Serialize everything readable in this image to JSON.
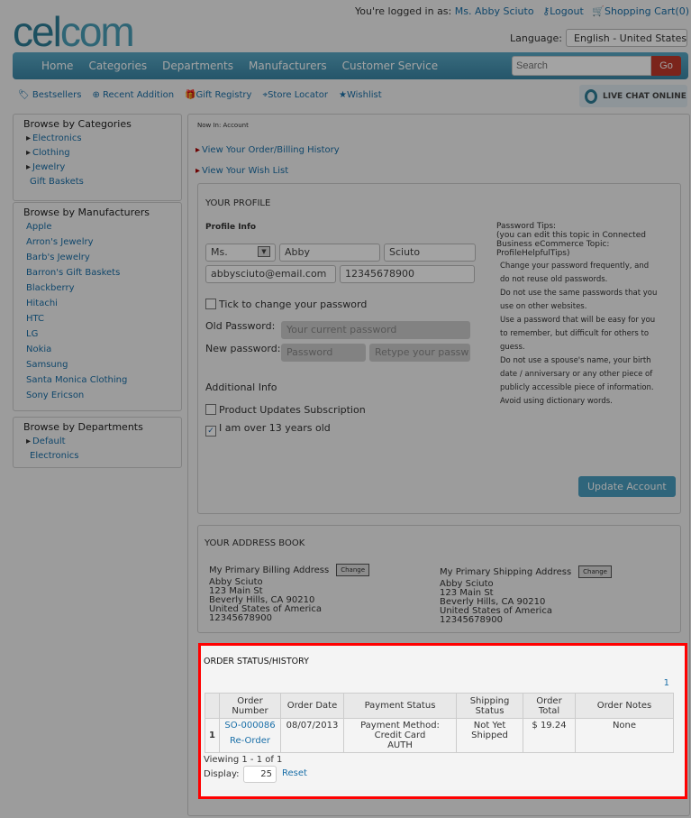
{
  "header": {
    "logo": "celcom",
    "logged_in_label": "You're logged in as:",
    "user": "Ms. Abby Sciuto",
    "logout": "Logout",
    "cart": "Shopping Cart(0)",
    "language_label": "Language:",
    "language": "English - United States"
  },
  "nav": {
    "items": [
      "Home",
      "Categories",
      "Departments",
      "Manufacturers",
      "Customer Service"
    ],
    "search_placeholder": "Search",
    "go": "Go"
  },
  "subnav": {
    "items": [
      "Bestsellers",
      "Recent Addition",
      "Gift Registry",
      "Store Locator",
      "Wishlist"
    ],
    "chat": "LIVE CHAT ONLINE"
  },
  "sidebar": {
    "categories": {
      "title": "Browse by Categories",
      "items": [
        "Electronics",
        "Clothing",
        "Jewelry",
        "Gift Baskets"
      ]
    },
    "manufacturers": {
      "title": "Browse by Manufacturers",
      "items": [
        "Apple",
        "Arron's Jewelry",
        "Barb's Jewelry",
        "Barron's Gift Baskets",
        "Blackberry",
        "Hitachi",
        "HTC",
        "LG",
        "Nokia",
        "Samsung",
        "Santa Monica Clothing",
        "Sony Ericson"
      ]
    },
    "departments": {
      "title": "Browse by Departments",
      "items": [
        "Default",
        "Electronics"
      ]
    }
  },
  "main": {
    "breadcrumb": "Now In: Account",
    "link_history": "View Your Order/Billing History",
    "link_wishlist": "View Your Wish List"
  },
  "profile": {
    "title": "YOUR PROFILE",
    "info_label": "Profile Info",
    "salutation": "Ms.",
    "first_name": "Abby",
    "last_name": "Sciuto",
    "email": "abbysciuto@email.com",
    "phone": "12345678900",
    "change_pw": "Tick to change your password",
    "old_pw_label": "Old Password:",
    "old_pw_placeholder": "Your current password",
    "new_pw_label": "New password:",
    "new_pw_placeholder": "Password",
    "retype_placeholder": "Retype your password",
    "additional": "Additional Info",
    "subscription": "Product Updates Subscription",
    "over13": "I am over 13 years old",
    "update": "Update Account",
    "tips_title": "Password Tips:",
    "tips_note": "(you can edit this topic in Connected Business eCommerce Topic: ProfileHelpfulTips)",
    "tips": [
      "Change your password frequently, and do not reuse old passwords.",
      "Do not use the same passwords that you use on other websites.",
      "Use a password that will be easy for you to remember, but difficult for others to guess.",
      "Do not use a spouse's name, your birth date / anniversary or any other piece of publicly accessible piece of information.",
      "Avoid using dictionary words."
    ]
  },
  "address": {
    "title": "YOUR ADDRESS BOOK",
    "change": "Change",
    "billing": {
      "label": "My Primary Billing Address",
      "lines": [
        "Abby Sciuto",
        "123 Main St",
        "Beverly Hills, CA 90210",
        "United States of America",
        "12345678900"
      ]
    },
    "shipping": {
      "label": "My Primary Shipping Address",
      "lines": [
        "Abby Sciuto",
        "123 Main St",
        "Beverly Hills, CA 90210",
        "United States of America",
        "12345678900"
      ]
    }
  },
  "orders": {
    "title": "ORDER STATUS/HISTORY",
    "page": "1",
    "columns": [
      "",
      "Order Number",
      "Order Date",
      "Payment Status",
      "Shipping Status",
      "Order Total",
      "Order Notes"
    ],
    "rows": [
      {
        "index": "1",
        "number": "SO-000086",
        "reorder": "Re-Order",
        "date": "08/07/2013",
        "payment": "Payment Method: Credit Card",
        "payment_status": "AUTH",
        "shipping": "Not Yet Shipped",
        "total": "$ 19.24",
        "notes": "None"
      }
    ],
    "viewing": "Viewing  1 - 1  of  1",
    "display_label": "Display:",
    "display_value": "25",
    "reset": "Reset"
  }
}
